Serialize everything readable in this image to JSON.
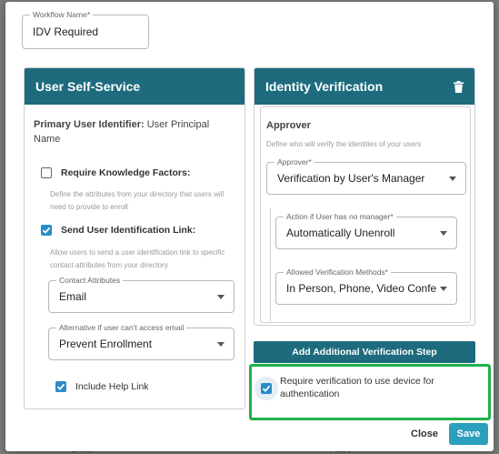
{
  "workflow_name": {
    "legend": "Workflow Name*",
    "value": "IDV Required"
  },
  "self_service": {
    "title": "User Self-Service",
    "primary_identifier_label": "Primary User Identifier:",
    "primary_identifier_value": "User Principal Name",
    "knowledge_factors": {
      "label": "Require Knowledge Factors:",
      "checked": false,
      "helper": "Define the attributes from your directory that users will need to provide to enroll"
    },
    "identification_link": {
      "label": "Send User Identification Link:",
      "checked": true,
      "helper": "Allow users to send a user identification link to specific contact attributes from your directory"
    },
    "contact_attributes": {
      "legend": "Contact Attributes",
      "value": "Email"
    },
    "alternative": {
      "legend": "Alternative if user can't access email",
      "value": "Prevent Enrollment"
    },
    "help_link": {
      "label": "Include Help Link",
      "checked": true
    }
  },
  "identity_verification": {
    "title": "Identity Verification",
    "trash_icon": "trash-icon",
    "approver_title": "Approver",
    "approver_helper": "Define who will verify the identities of your users",
    "approver": {
      "legend": "Approver*",
      "value": "Verification by User's Manager"
    },
    "no_manager": {
      "legend": "Action if User has no manager*",
      "value": "Automatically Unenroll"
    },
    "methods": {
      "legend": "Allowed Verification Methods*",
      "value": "In Person, Phone, Video Confere..."
    }
  },
  "add_step_label": "Add Additional Verification Step",
  "device_verification": {
    "label": "Require verification to use device for authentication",
    "checked": true,
    "highlight_color": "#22b04a"
  },
  "footer": {
    "close_label": "Close",
    "save_label": "Save"
  },
  "background": {
    "fragment_left": "Email",
    "fragment_right": "False"
  },
  "colors": {
    "header": "#1e6b7d",
    "checkbox": "#2a8cc8",
    "save": "#2c9fbd"
  }
}
